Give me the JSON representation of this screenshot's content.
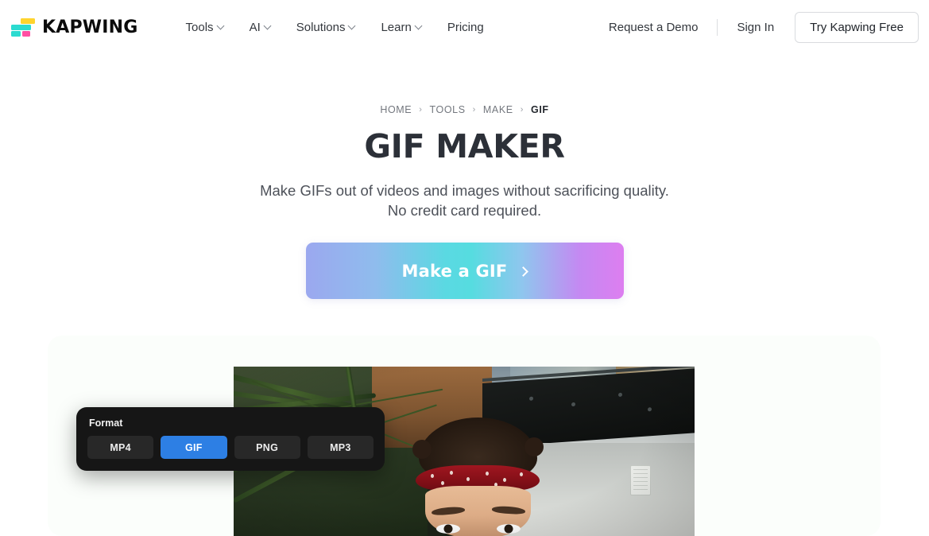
{
  "brand": {
    "name": "KAPWING",
    "logo_colors": {
      "yellow": "#ffd42e",
      "cyan": "#2bdbd0",
      "pink": "#ff4fa3"
    }
  },
  "nav": {
    "items": [
      {
        "label": "Tools",
        "has_dropdown": true
      },
      {
        "label": "AI",
        "has_dropdown": true
      },
      {
        "label": "Solutions",
        "has_dropdown": true
      },
      {
        "label": "Learn",
        "has_dropdown": true
      },
      {
        "label": "Pricing",
        "has_dropdown": false
      }
    ],
    "request_demo": "Request a Demo",
    "sign_in": "Sign In",
    "try_free": "Try Kapwing Free"
  },
  "breadcrumb": {
    "items": [
      "HOME",
      "TOOLS",
      "MAKE"
    ],
    "separator": "›",
    "current": "GIF"
  },
  "hero": {
    "title": "GIF MAKER",
    "subtitle_line1": "Make GIFs out of videos and images without sacrificing quality.",
    "subtitle_line2": "No credit card required.",
    "cta_label": "Make a GIF",
    "cta_arrow": "chevron-right-icon",
    "cta_gradient": {
      "left": "#9ba8ef",
      "middle": "#56dce0",
      "right": "#dd7ef0"
    }
  },
  "showcase": {
    "background_color": "#fbfefb",
    "format_panel": {
      "label": "Format",
      "panel_color": "#161616",
      "selected": "GIF",
      "selected_color": "#2d7fe4",
      "options": [
        {
          "label": "MP4",
          "selected": false
        },
        {
          "label": "GIF",
          "selected": true
        },
        {
          "label": "PNG",
          "selected": false
        },
        {
          "label": "MP3",
          "selected": false
        }
      ]
    },
    "video_preview": {
      "description": "Person wearing red bandana headband outdoors with palm fronds and a building"
    }
  }
}
